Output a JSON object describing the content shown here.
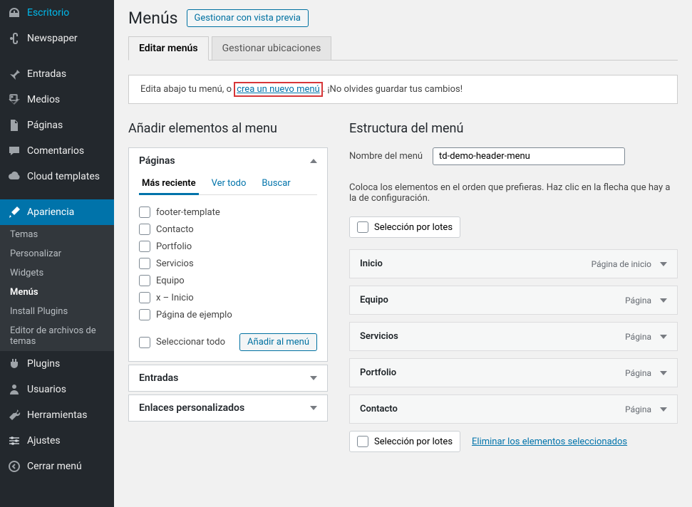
{
  "sidebar": {
    "items": [
      {
        "label": "Escritorio",
        "icon": "dashboard"
      },
      {
        "label": "Newspaper",
        "icon": "admin-links"
      },
      {
        "label": "Entradas",
        "icon": "pin"
      },
      {
        "label": "Medios",
        "icon": "media"
      },
      {
        "label": "Páginas",
        "icon": "page"
      },
      {
        "label": "Comentarios",
        "icon": "comment"
      },
      {
        "label": "Cloud templates",
        "icon": "cloud"
      },
      {
        "label": "Apariencia",
        "icon": "brush",
        "active": true
      },
      {
        "label": "Plugins",
        "icon": "plugin"
      },
      {
        "label": "Usuarios",
        "icon": "user"
      },
      {
        "label": "Herramientas",
        "icon": "tools"
      },
      {
        "label": "Ajustes",
        "icon": "settings"
      },
      {
        "label": "Cerrar menú",
        "icon": "collapse"
      }
    ],
    "submenu": [
      {
        "label": "Temas"
      },
      {
        "label": "Personalizar"
      },
      {
        "label": "Widgets"
      },
      {
        "label": "Menús",
        "current": true
      },
      {
        "label": "Install Plugins"
      },
      {
        "label": "Editor de archivos de temas"
      }
    ]
  },
  "page": {
    "title": "Menús",
    "preview_btn": "Gestionar con vista previa",
    "tabs": [
      {
        "label": "Editar menús",
        "active": true
      },
      {
        "label": "Gestionar ubicaciones"
      }
    ],
    "notice_pre": "Edita abajo tu menú, o ",
    "notice_link": "crea un nuevo menú",
    "notice_post": ". ¡No olvides guardar tus cambios!"
  },
  "left": {
    "title": "Añadir elementos al menu",
    "pages_box_title": "Páginas",
    "inner_tabs": [
      "Más reciente",
      "Ver todo",
      "Buscar"
    ],
    "pages": [
      "footer-template",
      "Contacto",
      "Portfolio",
      "Servicios",
      "Equipo",
      "x – Inicio",
      "Página de ejemplo"
    ],
    "select_all": "Seleccionar todo",
    "add_btn": "Añadir al menú",
    "entries_title": "Entradas",
    "custom_links_title": "Enlaces personalizados"
  },
  "right": {
    "title": "Estructura del menú",
    "name_label": "Nombre del menú",
    "name_value": "td-demo-header-menu",
    "help": "Coloca los elementos en el orden que prefieras. Haz clic en la flecha que hay a la de configuración.",
    "bulk_label": "Selección por lotes",
    "delete_link": "Eliminar los elementos seleccionados",
    "items": [
      {
        "title": "Inicio",
        "type": "Página de inicio"
      },
      {
        "title": "Equipo",
        "type": "Página"
      },
      {
        "title": "Servicios",
        "type": "Página"
      },
      {
        "title": "Portfolio",
        "type": "Página"
      },
      {
        "title": "Contacto",
        "type": "Página"
      }
    ]
  }
}
